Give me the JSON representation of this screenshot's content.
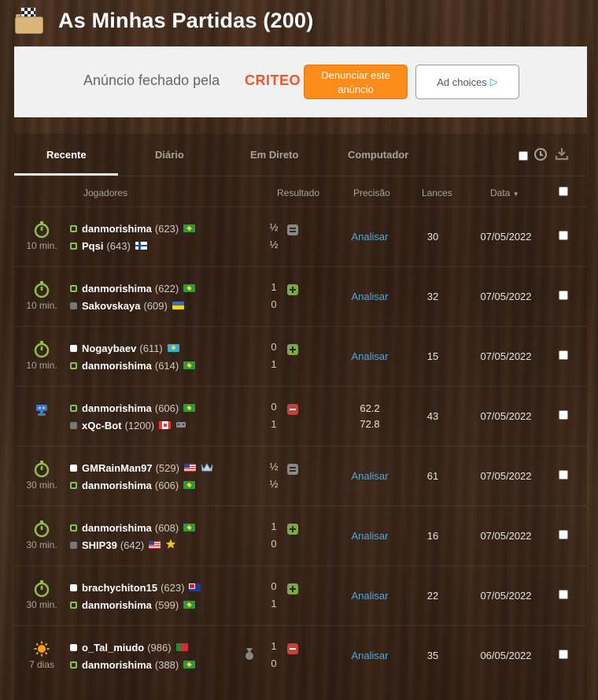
{
  "header": {
    "title": "As Minhas Partidas (200)"
  },
  "ad": {
    "text": "Anúncio fechado pela",
    "brand": "CRITEO",
    "report_label": "Denunciar este anúncio",
    "choices_label": "Ad choices"
  },
  "tabs": [
    {
      "label": "Recente"
    },
    {
      "label": "Diário"
    },
    {
      "label": "Em Direto"
    },
    {
      "label": "Computador"
    }
  ],
  "columns": {
    "players": "Jogadores",
    "result": "Resultado",
    "accuracy": "Precisão",
    "moves": "Lances",
    "date": "Data"
  },
  "analyze_label": "Analisar",
  "colors": {
    "win": "#7ea845",
    "loss": "#c6413a",
    "draw": "#8b8883",
    "link": "#54a5d8"
  },
  "games": [
    {
      "type": "10 min.",
      "icon": "stopwatch-icon",
      "p1": {
        "name": "danmorishima",
        "rating": "(623)",
        "flag": "br"
      },
      "p2": {
        "name": "Pqsi",
        "rating": "(643)",
        "flag": "fi"
      },
      "s1": "½",
      "s2": "½",
      "result": "draw",
      "moves": "30",
      "date": "07/05/2022"
    },
    {
      "type": "10 min.",
      "icon": "stopwatch-icon",
      "p1": {
        "name": "danmorishima",
        "rating": "(622)",
        "flag": "br"
      },
      "p2": {
        "name": "Sakovskaya",
        "rating": "(609)",
        "flag": "ua"
      },
      "s1": "1",
      "s2": "0",
      "result": "win",
      "moves": "32",
      "date": "07/05/2022"
    },
    {
      "type": "10 min.",
      "icon": "stopwatch-icon",
      "p1": {
        "name": "Nogaybaev",
        "rating": "(611)",
        "flag": "kz"
      },
      "p2": {
        "name": "danmorishima",
        "rating": "(614)",
        "flag": "br"
      },
      "s1": "0",
      "s2": "1",
      "result": "win",
      "moves": "15",
      "date": "07/05/2022"
    },
    {
      "type": "",
      "icon": "computer-icon",
      "p1": {
        "name": "danmorishima",
        "rating": "(606)",
        "flag": "br"
      },
      "p2": {
        "name": "xQc-Bot",
        "rating": "(1200)",
        "flag": "ca"
      },
      "s1": "0",
      "s2": "1",
      "result": "loss",
      "acc1": "62.2",
      "acc2": "72.8",
      "moves": "43",
      "date": "07/05/2022"
    },
    {
      "type": "30 min.",
      "icon": "stopwatch-icon",
      "p1": {
        "name": "GMRainMan97",
        "rating": "(529)",
        "flag": "us"
      },
      "p2": {
        "name": "danmorishima",
        "rating": "(606)",
        "flag": "br"
      },
      "s1": "½",
      "s2": "½",
      "result": "draw",
      "moves": "61",
      "date": "07/05/2022"
    },
    {
      "type": "30 min.",
      "icon": "stopwatch-icon",
      "p1": {
        "name": "danmorishima",
        "rating": "(608)",
        "flag": "br"
      },
      "p2": {
        "name": "SHIP39",
        "rating": "(642)",
        "flag": "us"
      },
      "s1": "1",
      "s2": "0",
      "result": "win",
      "moves": "16",
      "date": "07/05/2022"
    },
    {
      "type": "30 min.",
      "icon": "stopwatch-icon",
      "p1": {
        "name": "brachychiton15",
        "rating": "(623)",
        "flag": "au"
      },
      "p2": {
        "name": "danmorishima",
        "rating": "(599)",
        "flag": "br"
      },
      "s1": "0",
      "s2": "1",
      "result": "win",
      "moves": "22",
      "date": "07/05/2022"
    },
    {
      "type": "7 dias",
      "icon": "sun-icon",
      "p1": {
        "name": "o_Tal_miudo",
        "rating": "(986)",
        "flag": "pt"
      },
      "p2": {
        "name": "danmorishima",
        "rating": "(388)",
        "flag": "br"
      },
      "s1": "1",
      "s2": "0",
      "result": "loss",
      "moves": "35",
      "date": "06/05/2022"
    }
  ]
}
